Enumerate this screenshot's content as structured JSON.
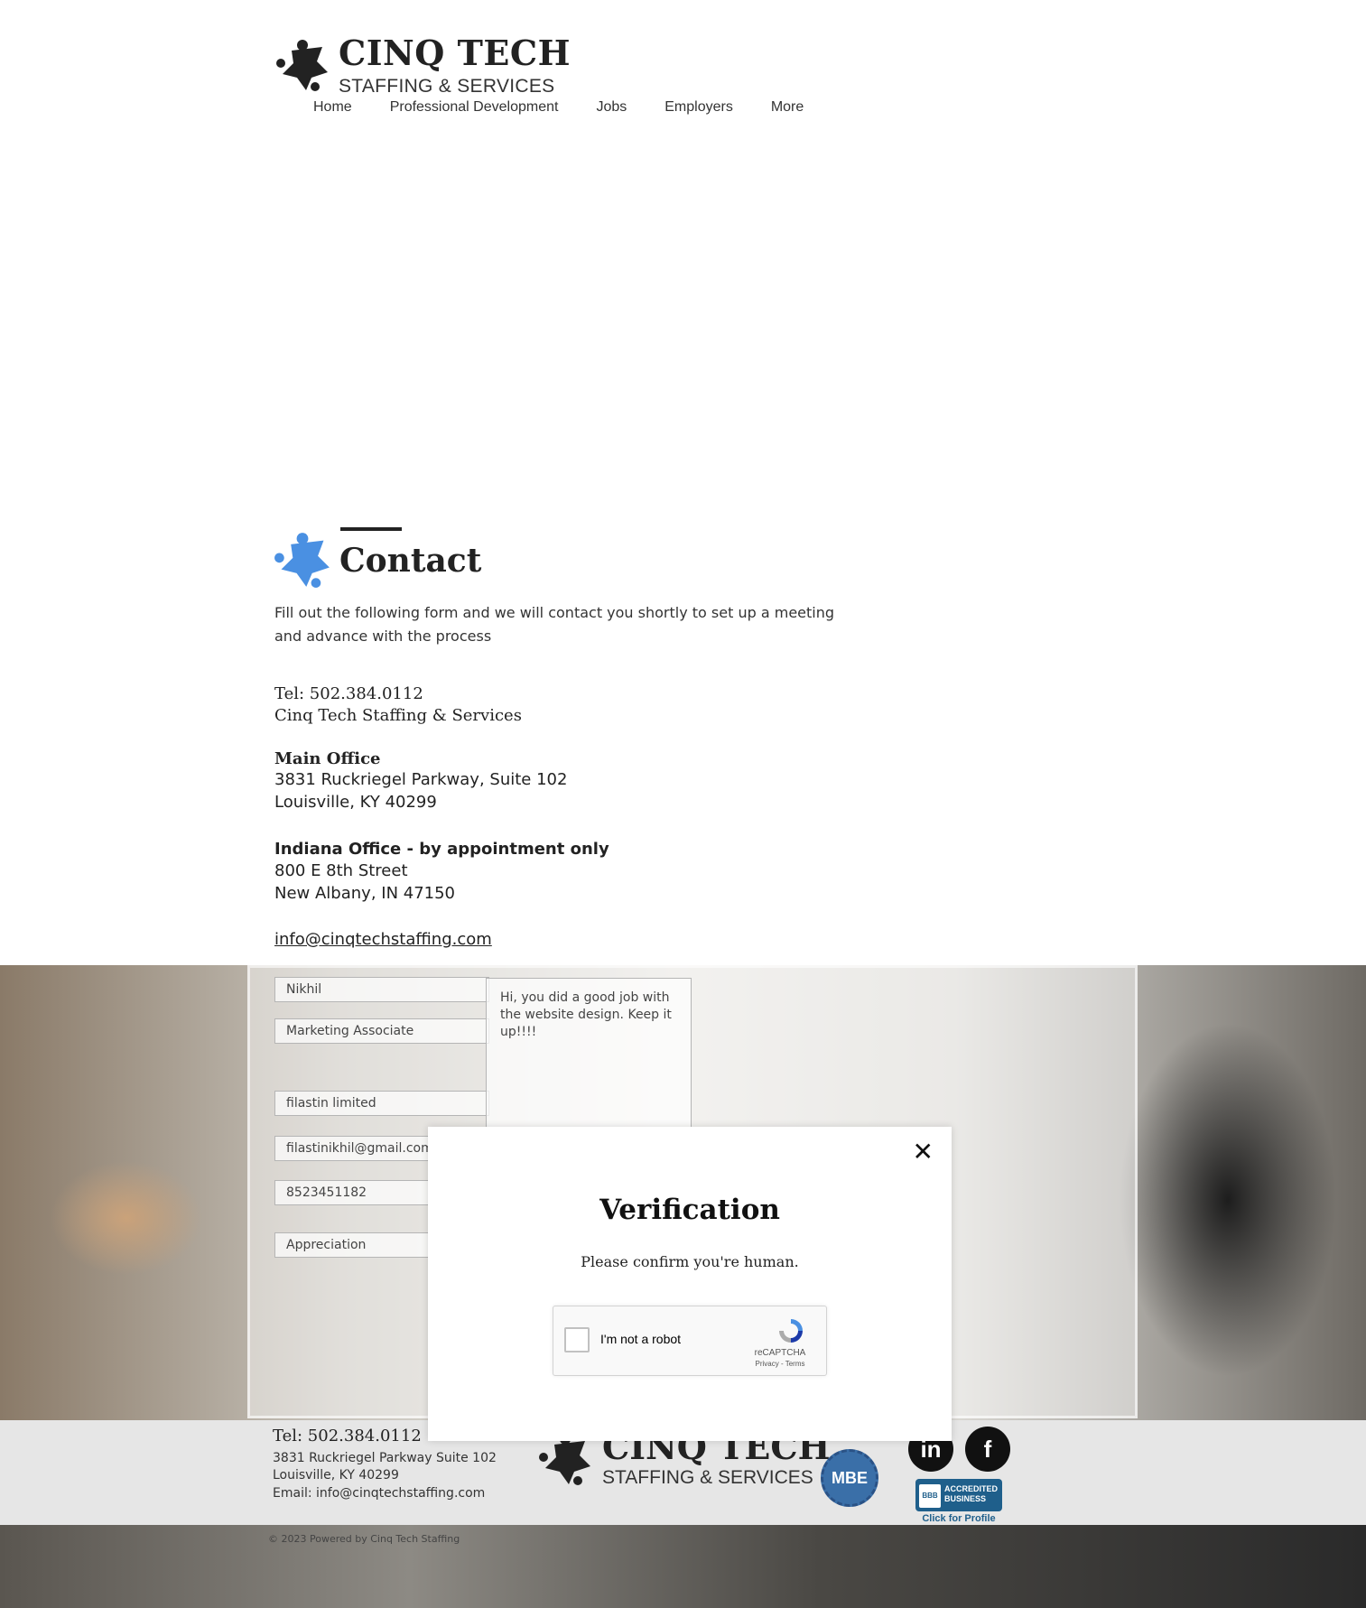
{
  "brand": {
    "title": "CINQ TECH",
    "subtitle": "STAFFING & SERVICES"
  },
  "nav": {
    "items": [
      "Home",
      "Professional Development",
      "Jobs",
      "Employers",
      "More"
    ]
  },
  "contact": {
    "heading": "Contact",
    "description": "Fill out the following form and we will contact you shortly to set up a meeting and advance with the process",
    "tel": "Tel: 502.384.0112",
    "company": "Cinq Tech Staffing & Services",
    "main_office": {
      "label": "Main Office",
      "line1": "3831 Ruckriegel Parkway, Suite 102",
      "line2": "Louisville, KY 40299"
    },
    "indiana_office": {
      "label": "Indiana Office - by appointment only",
      "line1": "800 E 8th Street",
      "line2": "New Albany, IN 47150"
    },
    "email": "info@cinqtechstaffing.com"
  },
  "form": {
    "name": "Nikhil",
    "title": "Marketing Associate",
    "company": "filastin limited",
    "email": "filastinikhil@gmail.com",
    "phone": "8523451182",
    "subject": "Appreciation",
    "message": "Hi, you did a good job with the website design. Keep it up!!!!"
  },
  "footer": {
    "tel": "Tel: 502.384.0112",
    "address_line1": "3831 Ruckriegel Parkway Suite 102",
    "address_line2": "Louisville, KY 40299",
    "email": "Email: info@cinqtechstaffing.com",
    "mbe_label": "MBE",
    "linkedin_label": "in",
    "facebook_label": "f",
    "bbb_label": "ACCREDITED BUSINESS",
    "bbb_short": "BBB",
    "bbb_cta": "Click for Profile",
    "copyright": "© 2023 Powered by Cinq Tech Staffing"
  },
  "modal": {
    "close_symbol": "✕",
    "title": "Verification",
    "subtitle": "Please confirm you're human.",
    "captcha_label": "I'm not a robot",
    "captcha_brand": "reCAPTCHA",
    "captcha_links": "Privacy - Terms"
  },
  "colors": {
    "brand_dark": "#222222",
    "brand_blue": "#4a90e2",
    "footer_bg": "#e6e6e6"
  }
}
